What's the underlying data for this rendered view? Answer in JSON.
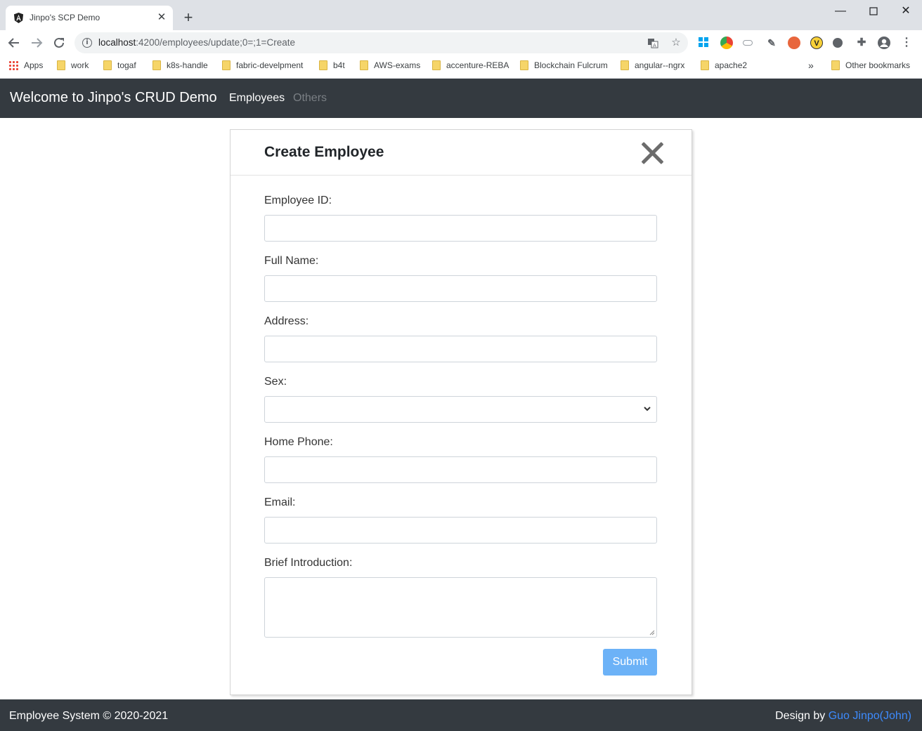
{
  "browser": {
    "tab_title": "Jinpo's SCP Demo",
    "url_host": "localhost",
    "url_path": ":4200/employees/update;0=;1=Create",
    "bookmarks": [
      {
        "label": "Apps",
        "icon": "apps-grid-icon"
      },
      {
        "label": "work",
        "icon": "folder-icon"
      },
      {
        "label": "togaf",
        "icon": "folder-icon"
      },
      {
        "label": "k8s-handle",
        "icon": "folder-icon"
      },
      {
        "label": "fabric-develpment",
        "icon": "folder-icon"
      },
      {
        "label": "b4t",
        "icon": "folder-icon"
      },
      {
        "label": "AWS-exams",
        "icon": "folder-icon"
      },
      {
        "label": "accenture-REBA",
        "icon": "folder-icon"
      },
      {
        "label": "Blockchain Fulcrum",
        "icon": "folder-icon"
      },
      {
        "label": "angular--ngrx",
        "icon": "folder-icon"
      },
      {
        "label": "apache2",
        "icon": "folder-icon"
      }
    ],
    "bookmarks_overflow": "»",
    "other_bookmarks": "Other bookmarks"
  },
  "navbar": {
    "brand": "Welcome to Jinpo's CRUD Demo",
    "links": [
      {
        "label": "Employees",
        "active": true
      },
      {
        "label": "Others",
        "active": false
      }
    ]
  },
  "form": {
    "title": "Create Employee",
    "fields": [
      {
        "label": "Employee ID:",
        "type": "text",
        "value": ""
      },
      {
        "label": "Full Name:",
        "type": "text",
        "value": ""
      },
      {
        "label": "Address:",
        "type": "text",
        "value": ""
      },
      {
        "label": "Sex:",
        "type": "select",
        "value": ""
      },
      {
        "label": "Home Phone:",
        "type": "text",
        "value": ""
      },
      {
        "label": "Email:",
        "type": "text",
        "value": ""
      },
      {
        "label": "Brief Introduction:",
        "type": "textarea",
        "value": ""
      }
    ],
    "submit_label": "Submit"
  },
  "footer": {
    "left": "Employee System © 2020-2021",
    "right_prefix": "Design by ",
    "right_link": "Guo Jinpo(John)"
  },
  "colors": {
    "navbar_bg": "#343a40",
    "submit_bg": "#6cb2f7",
    "link_blue": "#3d8bfd"
  }
}
